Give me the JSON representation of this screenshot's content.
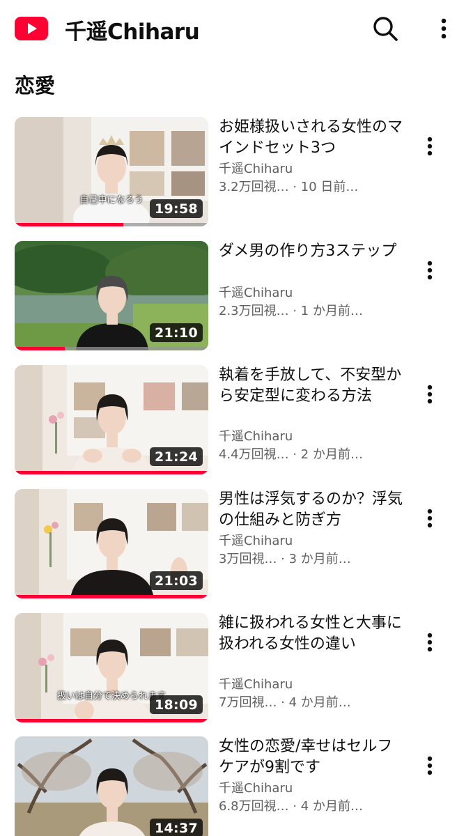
{
  "header": {
    "channel_name": "千遥Chiharu",
    "icons": {
      "logo": "youtube-logo-icon",
      "search": "search-icon",
      "more": "more-vert-icon"
    },
    "brand_color": "#ff0033"
  },
  "section": {
    "title": "恋愛"
  },
  "videos": [
    {
      "title": "お姫様扱いされる女性のマインドセット3つ",
      "channel": "千遥Chiharu",
      "stats": "3.2万回視… · 10 日前…",
      "duration": "19:58",
      "overlay_text": "自己中になろう",
      "watched_fraction": 0.56
    },
    {
      "title": "ダメ男の作り方3ステップ",
      "channel": "千遥Chiharu",
      "stats": "2.3万回視… · 1 か月前…",
      "duration": "21:10",
      "overlay_text": "",
      "watched_fraction": 0.26
    },
    {
      "title": "執着を手放して、不安型から安定型に変わる方法",
      "channel": "千遥Chiharu",
      "stats": "4.4万回視… · 2 か月前…",
      "duration": "21:24",
      "overlay_text": "",
      "watched_fraction": 1.0
    },
    {
      "title": "男性は浮気するのか？浮気の仕組みと防ぎ方",
      "channel": "千遥Chiharu",
      "stats": "3万回視… · 3 か月前…",
      "duration": "21:03",
      "overlay_text": "",
      "watched_fraction": 1.0
    },
    {
      "title": "雑に扱われる女性と大事に扱われる女性の違い",
      "channel": "千遥Chiharu",
      "stats": "7万回視… · 4 か月前…",
      "duration": "18:09",
      "overlay_text": "扱いは自分で決められます",
      "watched_fraction": 1.0
    },
    {
      "title": "女性の恋愛/幸せはセルフケアが9割です",
      "channel": "千遥Chiharu",
      "stats": "6.8万回視… · 4 か月前…",
      "duration": "14:37",
      "overlay_text": "",
      "watched_fraction": 0.0
    }
  ]
}
